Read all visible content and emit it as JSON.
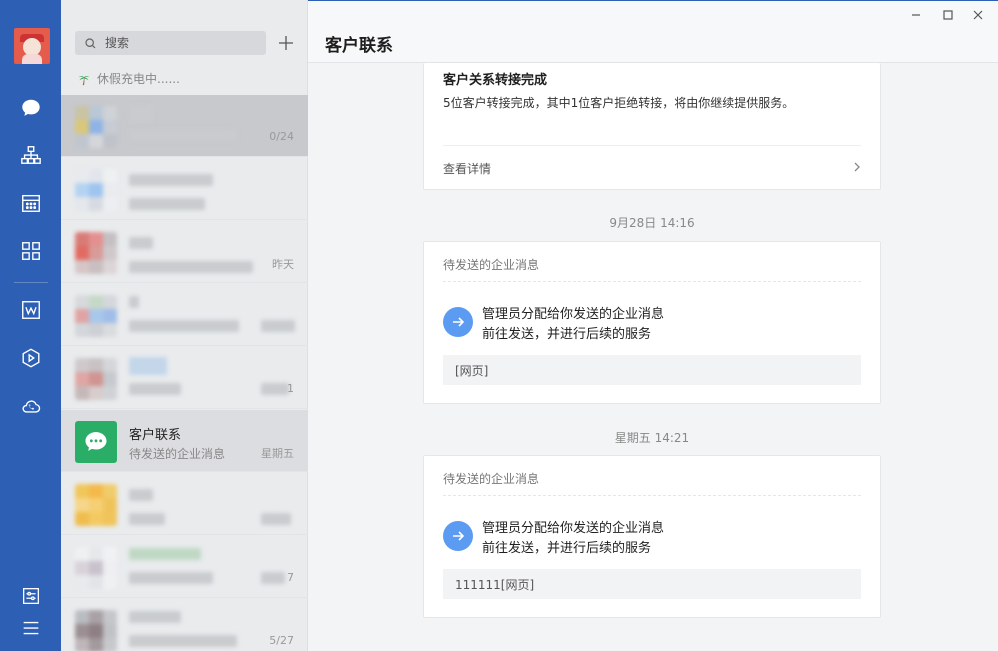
{
  "list": {
    "search_placeholder": "搜索",
    "status_text": "休假充电中......",
    "conversations": [
      {
        "time": "0/24"
      },
      {
        "time": ""
      },
      {
        "time": "昨天"
      },
      {
        "time": ""
      },
      {
        "time": "1"
      },
      {
        "name": "客户联系",
        "preview": "待发送的企业消息",
        "time": "星期五"
      },
      {
        "time": ""
      },
      {
        "time": "7"
      },
      {
        "time": "5/27"
      }
    ]
  },
  "main": {
    "title": "客户联系",
    "transfer_card": {
      "title": "客户关系转接完成",
      "desc": "5位客户转接完成，其中1位客户拒绝转接，将由你继续提供服务。",
      "link": "查看详情"
    },
    "messages": [
      {
        "timestamp": "9月28日 14:16",
        "header": "待发送的企业消息",
        "line1": "管理员分配给你发送的企业消息",
        "line2": "前往发送，并进行后续的服务",
        "attachment": "[网页]"
      },
      {
        "timestamp": "星期五 14:21",
        "header": "待发送的企业消息",
        "line1": "管理员分配给你发送的企业消息",
        "line2": "前往发送，并进行后续的服务",
        "attachment": "111111[网页]"
      }
    ]
  },
  "colors": {
    "rail": "#2d5fb4",
    "accent": "#5b9cf2",
    "wechat": "#2aae67"
  }
}
